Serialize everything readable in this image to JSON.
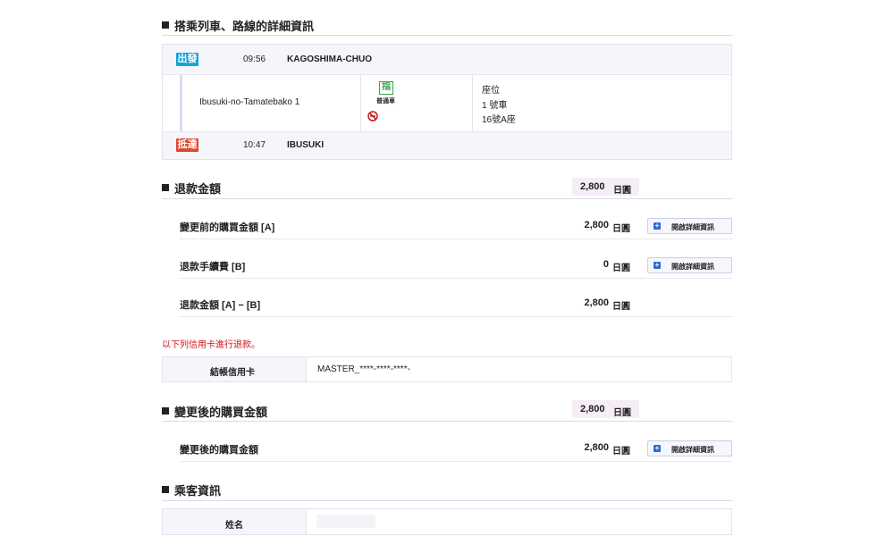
{
  "train": {
    "title": "搭乘列車、路線的詳細資訊",
    "depart": {
      "badge": "出發",
      "time": "09:56",
      "station": "KAGOSHIMA-CHUO",
      "color": "#1aa1d6"
    },
    "train_name": "Ibusuki-no-Tamatebako 1",
    "reserved_icon_label": "指",
    "car_class_label": "普通車",
    "seat": {
      "label": "座位",
      "car": "1 號車",
      "seat": "16號A座"
    },
    "arrive": {
      "badge": "抵達",
      "time": "10:47",
      "station": "IBUSUKI",
      "color": "#e2452a"
    }
  },
  "refund": {
    "title": "退款金額",
    "total": "2,800",
    "currency": "日圓",
    "rows": [
      {
        "label": "變更前的購買金額 [A]",
        "amount": "2,800",
        "currency": "日圓",
        "button": "開啟詳細資訊"
      },
      {
        "label": "退款手續費 [B]",
        "amount": "0",
        "currency": "日圓",
        "button": "開啟詳細資訊"
      },
      {
        "label": "退款金額 [A] − [B]",
        "amount": "2,800",
        "currency": "日圓"
      }
    ]
  },
  "card": {
    "notice": "以下列信用卡進行退款。",
    "label": "結帳信用卡",
    "value": "MASTER_****-****-****-"
  },
  "after": {
    "title": "變更後的購買金額",
    "total": "2,800",
    "currency": "日圓",
    "row": {
      "label": "變更後的購買金額",
      "amount": "2,800",
      "currency": "日圓",
      "button": "開啟詳細資訊"
    }
  },
  "passenger": {
    "title": "乘客資訊",
    "name_label": "姓名"
  },
  "colors": {
    "accent_blue": "#2d6ad6",
    "notice_red": "#d0101b",
    "pink_chip": "#f6edf6"
  }
}
